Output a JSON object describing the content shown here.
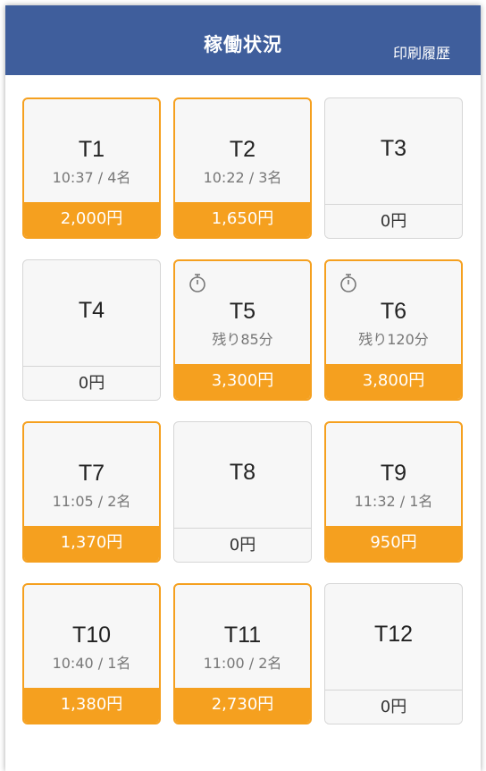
{
  "header": {
    "title": "稼働状況",
    "print_label": "印刷履歴"
  },
  "colors": {
    "header_bg": "#3f5e9c",
    "accent": "#f5a01f",
    "inactive_bg": "#f7f7f7"
  },
  "tables": [
    {
      "name": "T1",
      "sub": "10:37 / 4名",
      "amount": "2,000円",
      "active": true,
      "timer": false
    },
    {
      "name": "T2",
      "sub": "10:22 / 3名",
      "amount": "1,650円",
      "active": true,
      "timer": false
    },
    {
      "name": "T3",
      "sub": "",
      "amount": "0円",
      "active": false,
      "timer": false
    },
    {
      "name": "T4",
      "sub": "",
      "amount": "0円",
      "active": false,
      "timer": false
    },
    {
      "name": "T5",
      "sub": "残り85分",
      "amount": "3,300円",
      "active": true,
      "timer": true
    },
    {
      "name": "T6",
      "sub": "残り120分",
      "amount": "3,800円",
      "active": true,
      "timer": true
    },
    {
      "name": "T7",
      "sub": "11:05 / 2名",
      "amount": "1,370円",
      "active": true,
      "timer": false
    },
    {
      "name": "T8",
      "sub": "",
      "amount": "0円",
      "active": false,
      "timer": false
    },
    {
      "name": "T9",
      "sub": "11:32 / 1名",
      "amount": "950円",
      "active": true,
      "timer": false
    },
    {
      "name": "T10",
      "sub": "10:40 / 1名",
      "amount": "1,380円",
      "active": true,
      "timer": false
    },
    {
      "name": "T11",
      "sub": "11:00 / 2名",
      "amount": "2,730円",
      "active": true,
      "timer": false
    },
    {
      "name": "T12",
      "sub": "",
      "amount": "0円",
      "active": false,
      "timer": false
    }
  ],
  "icons": {
    "timer": "stopwatch-icon"
  }
}
